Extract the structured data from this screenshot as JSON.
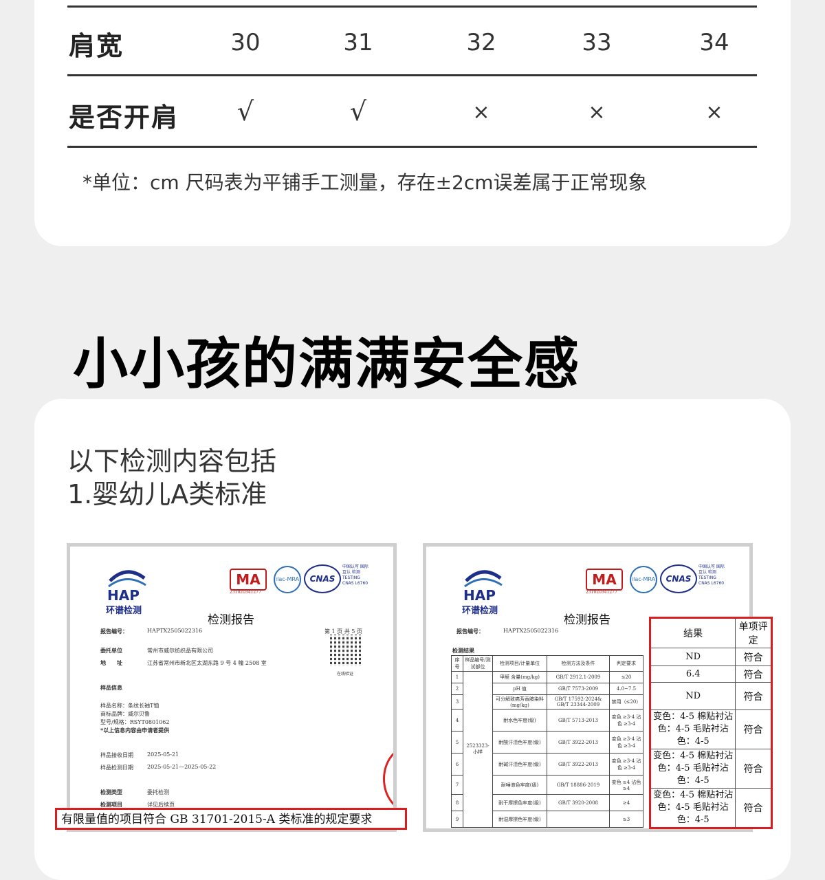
{
  "size_table": {
    "rows": [
      {
        "label": "肩宽",
        "values": [
          "30",
          "31",
          "32",
          "33",
          "34"
        ]
      },
      {
        "label": "是否开肩",
        "values": [
          "√",
          "√",
          "×",
          "×",
          "×"
        ]
      }
    ],
    "note": "*单位：cm 尺码表为平铺手工测量，存在±2cm误差属于正常现象"
  },
  "section": {
    "title": "小小孩的满满安全感",
    "intro_line1": "以下检测内容包括",
    "intro_line2": "1.婴幼儿A类标准"
  },
  "report_left": {
    "brand": "环谱检测",
    "logo": "HAP",
    "ma": "MA",
    "ma_number": "231020341277",
    "ilac": "ilac-MRA",
    "cnas": "CNAS",
    "cnas_text": "中国认可 国际互认 检测 TESTING CNAS L6760",
    "title": "检测报告",
    "report_no_label": "报告编号：",
    "report_no": "HAPTX2505022316",
    "page": "第 1 页 共 5 页",
    "client_label": "委托单位",
    "client": "常州市威尔纺织品有限公司",
    "address_label": "地　　址",
    "address": "江苏省常州市新北区太湖东路 9 号 4 幢 2508 室",
    "qr_caption": "在线验证",
    "sample_info": "样品信息",
    "sample_name": "样品名称：条纹长袖T恤",
    "brand_name": "商标品牌：威尔贝鲁",
    "model": "型号/规格：RSYT0801062",
    "declared": "*以上信息内容由申请者提供",
    "received_label": "样品接收日期",
    "received": "2025-05-21",
    "tested_label": "样品检测日期",
    "tested": "2025-05-21—2025-05-22",
    "type_label": "检测类型",
    "type": "委托检测",
    "items_label": "检测项目",
    "items": "详见后续页"
  },
  "banner": "有限量值的项目符合 GB 31701-2015-A 类标准的规定要求",
  "report_right": {
    "title": "检测报告",
    "report_no_label": "报告编号：",
    "report_no": "HAPTX2505022316",
    "results_label": "检测结果",
    "headers": [
      "序号",
      "样品编号/测试部位",
      "检测项目/计量单位",
      "检测方法及条件",
      "判定要求"
    ],
    "sample": "2523323-小样",
    "rows": [
      {
        "no": "1",
        "item": "甲醛 含量(mg/kg)",
        "method": "GB/T 2912.1-2009",
        "req": "≤20"
      },
      {
        "no": "2",
        "item": "pH 值",
        "method": "GB/T 7573-2009",
        "req": "4.0~7.5"
      },
      {
        "no": "3",
        "item": "可分解致癌芳香胺染料(mg/kg)",
        "method": "GB/T 17592-2024& GB/T 23344-2009",
        "req": "禁用（≤20）"
      },
      {
        "no": "4",
        "item": "耐水色牢度(级)",
        "method": "GB/T 5713-2013",
        "req": "变色 ≥3-4 沾色 ≥3-4"
      },
      {
        "no": "5",
        "item": "耐酸汗渍色牢度(级)",
        "method": "GB/T 3922-2013",
        "req": "变色 ≥3-4 沾色 ≥3-4"
      },
      {
        "no": "6",
        "item": "耐碱汗渍色牢度(级)",
        "method": "GB/T 3922-2013",
        "req": "变色 ≥3-4 沾色 ≥3-4"
      },
      {
        "no": "7",
        "item": "耐唾液色牢度(级)",
        "method": "GB/T 18886-2019",
        "req": "变色 ≥4 沾色 ≥4"
      },
      {
        "no": "8",
        "item": "耐干摩擦色牢度(级)",
        "method": "GB/T 3920-2008",
        "req": "≥4"
      },
      {
        "no": "9",
        "item": "耐湿摩擦色牢度(级)",
        "method": "",
        "req": "≥3"
      }
    ]
  },
  "zoom_table": {
    "header_result": "结果",
    "header_verdict": "单项评定",
    "rows": [
      {
        "result": "ND",
        "verdict": "符合"
      },
      {
        "result": "6.4",
        "verdict": "符合"
      },
      {
        "result": "ND",
        "verdict": "符合"
      },
      {
        "result": "变色：4-5 棉贴衬沾色：4-5 毛贴衬沾色：4-5",
        "verdict": "符合"
      },
      {
        "result": "变色：4-5 棉贴衬沾色：4-5 毛贴衬沾色：4-5",
        "verdict": "符合"
      },
      {
        "result": "变色：4-5 棉贴衬沾色：4-5 毛贴衬沾色：4-5",
        "verdict": "符合"
      }
    ]
  },
  "colors": {
    "accent_red": "#d81e1e",
    "brand_blue": "#1e2f8a",
    "background": "#efefef"
  }
}
